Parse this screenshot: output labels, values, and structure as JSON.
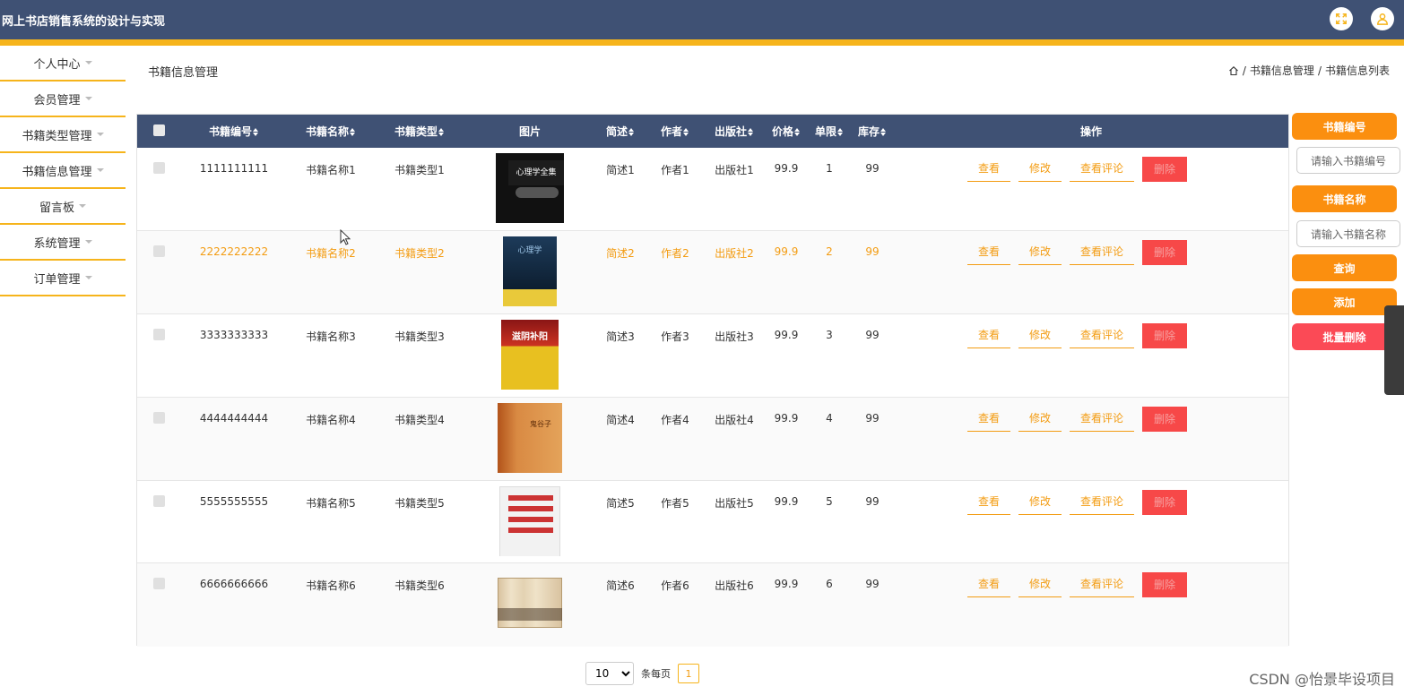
{
  "header": {
    "title": "网上书店销售系统的设计与实现",
    "fullscreen_icon": "fullscreen-icon",
    "user_icon": "user-icon"
  },
  "sidebar": {
    "items": [
      {
        "label": "个人中心"
      },
      {
        "label": "会员管理"
      },
      {
        "label": "书籍类型管理"
      },
      {
        "label": "书籍信息管理"
      },
      {
        "label": "留言板"
      },
      {
        "label": "系统管理"
      },
      {
        "label": "订单管理"
      }
    ]
  },
  "page": {
    "title": "书籍信息管理",
    "breadcrumb": [
      "书籍信息管理",
      "书籍信息列表"
    ],
    "breadcrumb_sep": "/"
  },
  "table": {
    "columns": [
      "书籍编号",
      "书籍名称",
      "书籍类型",
      "图片",
      "简述",
      "作者",
      "出版社",
      "价格",
      "单限",
      "库存",
      "操作"
    ],
    "ops": {
      "view": "查看",
      "edit": "修改",
      "comments": "查看评论",
      "delete": "删除"
    },
    "rows": [
      {
        "id": "1111111111",
        "name": "书籍名称1",
        "type": "书籍类型1",
        "desc": "简述1",
        "author": "作者1",
        "publisher": "出版社1",
        "price": "99.9",
        "limit": "1",
        "stock": "99",
        "cover": "心理学全集"
      },
      {
        "id": "2222222222",
        "name": "书籍名称2",
        "type": "书籍类型2",
        "desc": "简述2",
        "author": "作者2",
        "publisher": "出版社2",
        "price": "99.9",
        "limit": "2",
        "stock": "99",
        "cover": "心理学"
      },
      {
        "id": "3333333333",
        "name": "书籍名称3",
        "type": "书籍类型3",
        "desc": "简述3",
        "author": "作者3",
        "publisher": "出版社3",
        "price": "99.9",
        "limit": "3",
        "stock": "99",
        "cover": "滋阴补阳"
      },
      {
        "id": "4444444444",
        "name": "书籍名称4",
        "type": "书籍类型4",
        "desc": "简述4",
        "author": "作者4",
        "publisher": "出版社4",
        "price": "99.9",
        "limit": "4",
        "stock": "99",
        "cover": "鬼谷子"
      },
      {
        "id": "5555555555",
        "name": "书籍名称5",
        "type": "书籍类型5",
        "desc": "简述5",
        "author": "作者5",
        "publisher": "出版社5",
        "price": "99.9",
        "limit": "5",
        "stock": "99",
        "cover": ""
      },
      {
        "id": "6666666666",
        "name": "书籍名称6",
        "type": "书籍类型6",
        "desc": "简述6",
        "author": "作者6",
        "publisher": "出版社6",
        "price": "99.9",
        "limit": "6",
        "stock": "99",
        "cover": ""
      }
    ]
  },
  "search": {
    "id_label": "书籍编号",
    "id_placeholder": "请输入书籍编号",
    "name_label": "书籍名称",
    "name_placeholder": "请输入书籍名称",
    "query": "查询",
    "add": "添加",
    "batch_delete": "批量删除"
  },
  "pager": {
    "page_size": "10",
    "per_page_label": "条每页",
    "current_page": "1"
  },
  "watermark": "CSDN @怡景毕设项目",
  "colors": {
    "header_bg": "#3f5174",
    "accent_yellow": "#f6b41b",
    "orange": "#fb8f0f",
    "red": "#fb4a56",
    "highlight_text": "#f39c12"
  }
}
